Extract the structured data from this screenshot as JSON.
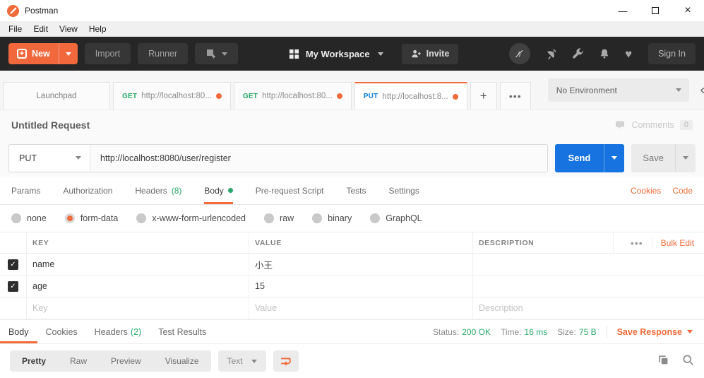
{
  "titlebar": {
    "app_name": "Postman"
  },
  "menubar": {
    "items": [
      "File",
      "Edit",
      "View",
      "Help"
    ]
  },
  "toolbar": {
    "new_label": "New",
    "import_label": "Import",
    "runner_label": "Runner",
    "workspace_label": "My Workspace",
    "invite_label": "Invite",
    "signin_label": "Sign In"
  },
  "tabbar": {
    "tabs": [
      {
        "method": "",
        "title": "Launchpad"
      },
      {
        "method": "GET",
        "title": "http://localhost:80..."
      },
      {
        "method": "GET",
        "title": "http://localhost:80..."
      },
      {
        "method": "PUT",
        "title": "http://localhost:8..."
      }
    ],
    "environment_selected": "No Environment"
  },
  "request": {
    "name": "Untitled Request",
    "comments_label": "Comments",
    "comments_count": "0",
    "method": "PUT",
    "url": "http://localhost:8080/user/register",
    "send_label": "Send",
    "save_label": "Save",
    "tabs": [
      {
        "label": "Params"
      },
      {
        "label": "Authorization"
      },
      {
        "label": "Headers",
        "count": "(8)"
      },
      {
        "label": "Body"
      },
      {
        "label": "Pre-request Script"
      },
      {
        "label": "Tests"
      },
      {
        "label": "Settings"
      }
    ],
    "cookies_link": "Cookies",
    "code_link": "Code",
    "body_types": [
      "none",
      "form-data",
      "x-www-form-urlencoded",
      "raw",
      "binary",
      "GraphQL"
    ],
    "body_type_selected": "form-data",
    "table": {
      "headers": [
        "KEY",
        "VALUE",
        "DESCRIPTION"
      ],
      "bulk_edit_label": "Bulk Edit",
      "rows": [
        {
          "checked": true,
          "key": "name",
          "value": "小王",
          "description": ""
        },
        {
          "checked": true,
          "key": "age",
          "value": "15",
          "description": ""
        }
      ],
      "placeholder_row": {
        "key": "Key",
        "value": "Value",
        "description": "Description"
      }
    }
  },
  "response": {
    "tabs": [
      {
        "label": "Body"
      },
      {
        "label": "Cookies"
      },
      {
        "label": "Headers",
        "count": "(2)"
      },
      {
        "label": "Test Results"
      }
    ],
    "status_label": "Status:",
    "status_value": "200 OK",
    "time_label": "Time:",
    "time_value": "16 ms",
    "size_label": "Size:",
    "size_value": "75 B",
    "save_response_label": "Save Response",
    "view_modes": [
      "Pretty",
      "Raw",
      "Preview",
      "Visualize"
    ],
    "view_mode_selected": "Pretty",
    "format_selected": "Text"
  },
  "icons": {
    "check": "✓",
    "plus": "+",
    "ellipsis": "•••",
    "heart": "♥",
    "minimize": "—",
    "close": "×"
  },
  "colors": {
    "accent_orange": "#F26B3A",
    "success_green": "#29A96C",
    "send_blue": "#1673E0",
    "method_get_green": "#29A96C",
    "method_put_blue": "#0C7BDC"
  }
}
